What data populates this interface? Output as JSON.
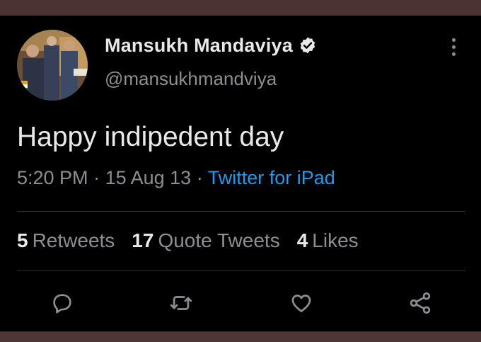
{
  "tweet": {
    "display_name": "Mansukh Mandaviya",
    "handle": "@mansukhmandviya",
    "text": "Happy indipedent day",
    "time": "5:20 PM",
    "date": "15 Aug 13",
    "separator": " · ",
    "source": "Twitter for iPad",
    "stats": {
      "retweets_count": "5",
      "retweets_label": "Retweets",
      "quote_count": "17",
      "quote_label": "Quote Tweets",
      "likes_count": "4",
      "likes_label": "Likes"
    }
  },
  "icons": {
    "verified": "verified-badge-icon",
    "more": "more-options-icon",
    "reply": "reply-icon",
    "retweet": "retweet-icon",
    "like": "heart-icon",
    "share": "share-icon"
  },
  "colors": {
    "background": "#000000",
    "text": "#e7e9ea",
    "secondary": "#8b8f94",
    "link": "#1d9bf0",
    "frame": "#4b3331"
  }
}
